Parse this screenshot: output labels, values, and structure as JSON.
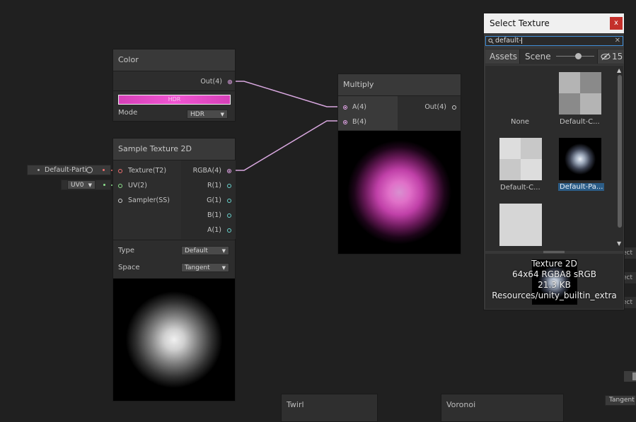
{
  "color_node": {
    "title": "Color",
    "out_label": "Out(4)",
    "hdr_label": "HDR",
    "mode_label": "Mode",
    "mode_value": "HDR",
    "swatch_color": "#e040c0"
  },
  "sample_node": {
    "title": "Sample Texture 2D",
    "inputs": [
      "Texture(T2)",
      "UV(2)",
      "Sampler(SS)"
    ],
    "outputs": [
      "RGBA(4)",
      "R(1)",
      "G(1)",
      "B(1)",
      "A(1)"
    ],
    "type_label": "Type",
    "type_value": "Default",
    "space_label": "Space",
    "space_value": "Tangent",
    "texture_input_value": "Default-Parti",
    "uv_input_value": "UV0"
  },
  "multiply_node": {
    "title": "Multiply",
    "inputs": [
      "A(4)",
      "B(4)"
    ],
    "output": "Out(4)"
  },
  "bottom_nodes": {
    "twirl": "Twirl",
    "voronoi": "Voronoi"
  },
  "popup": {
    "title": "Select Texture",
    "close": "x",
    "search_value": "default-",
    "tabs": {
      "assets": "Assets",
      "scene": "Scene",
      "hidden_count": "15"
    },
    "items": [
      {
        "label": "None"
      },
      {
        "label": "Default-C..."
      },
      {
        "label": "Default-C..."
      },
      {
        "label": "Default-Pa..."
      }
    ],
    "info": {
      "type": "Texture 2D",
      "format": "64x64  RGBA8 sRGB",
      "size": "21.3 KB",
      "path": "Resources/unity_builtin_extra"
    }
  },
  "edge_fragments": {
    "a": "ect",
    "b": "ect",
    "c": "ect",
    "tangent": "Tangent"
  },
  "colors": {
    "wire": "#d9a8e0",
    "teal_port": "#6ad4cf",
    "selected": "#2c5d87",
    "close": "#c4302b"
  },
  "icons": {
    "search": "search-icon",
    "close": "close-icon",
    "hidden": "eye-slash-icon",
    "dropdown": "chevron-down-icon",
    "target": "object-picker-icon"
  }
}
